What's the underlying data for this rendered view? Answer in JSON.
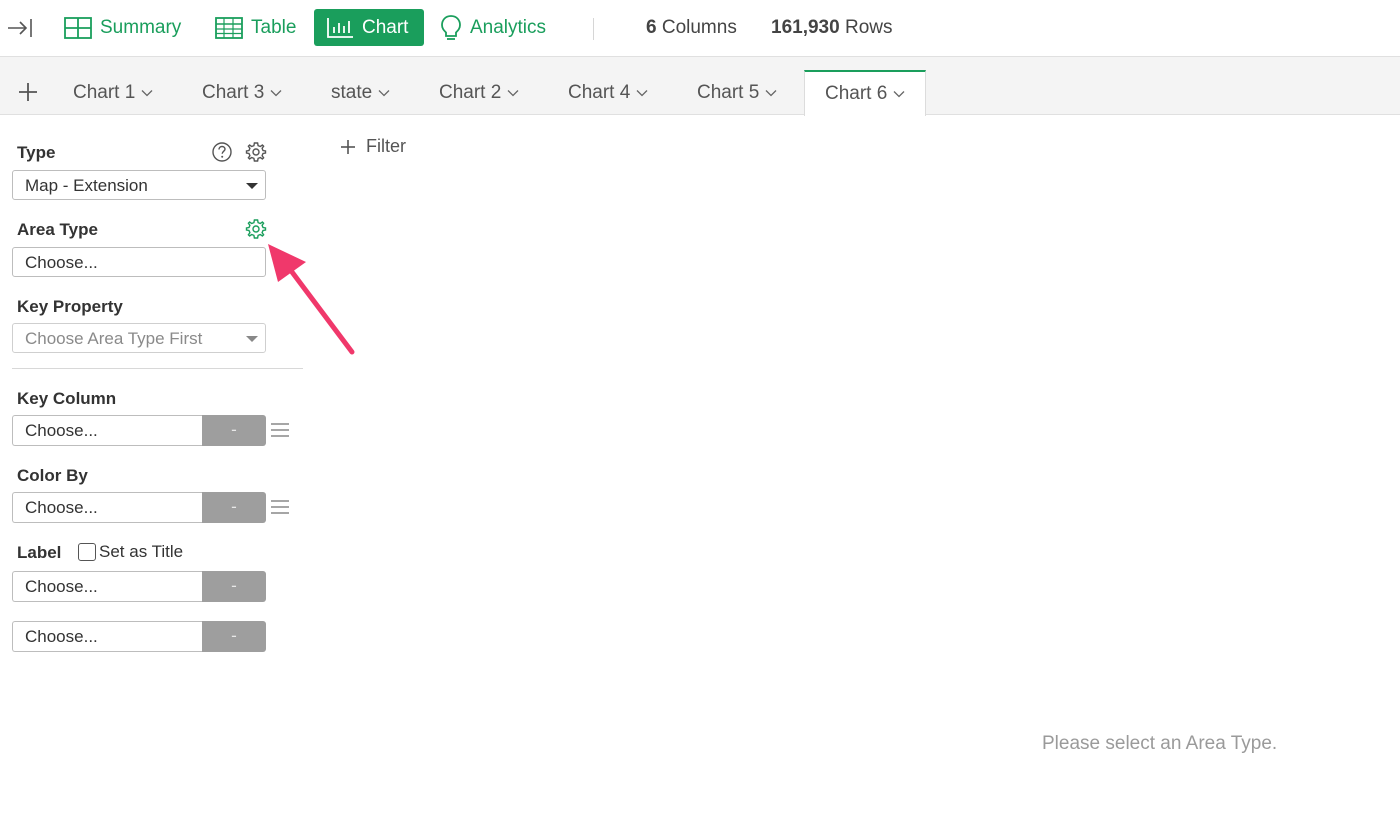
{
  "toolbar": {
    "nav": [
      {
        "label": "Summary",
        "icon": "grid-icon",
        "active": false
      },
      {
        "label": "Table",
        "icon": "table-icon",
        "active": false
      },
      {
        "label": "Chart",
        "icon": "chart-icon",
        "active": true
      },
      {
        "label": "Analytics",
        "icon": "bulb-icon",
        "active": false
      }
    ],
    "columns_count": "6",
    "columns_label": "Columns",
    "rows_count": "161,930",
    "rows_label": "Rows"
  },
  "tabs": [
    {
      "label": "Chart 1",
      "active": false
    },
    {
      "label": "Chart 3",
      "active": false
    },
    {
      "label": "state",
      "active": false
    },
    {
      "label": "Chart 2",
      "active": false
    },
    {
      "label": "Chart 4",
      "active": false
    },
    {
      "label": "Chart 5",
      "active": false
    },
    {
      "label": "Chart 6",
      "active": true
    }
  ],
  "panel": {
    "type_label": "Type",
    "type_value": "Map - Extension",
    "area_type_label": "Area Type",
    "area_type_value": "Choose...",
    "key_property_label": "Key Property",
    "key_property_value": "Choose Area Type First",
    "key_column_label": "Key Column",
    "key_column_value": "Choose...",
    "key_column_dash": "-",
    "color_by_label": "Color By",
    "color_by_value": "Choose...",
    "color_by_dash": "-",
    "label_label": "Label",
    "set_as_title_label": "Set as Title",
    "label1_value": "Choose...",
    "label1_dash": "-",
    "label2_value": "Choose...",
    "label2_dash": "-"
  },
  "main": {
    "filter_label": "Filter",
    "empty_message": "Please select an Area Type."
  },
  "colors": {
    "accent": "#1a9e5c",
    "annotation_arrow": "#f0386b"
  }
}
